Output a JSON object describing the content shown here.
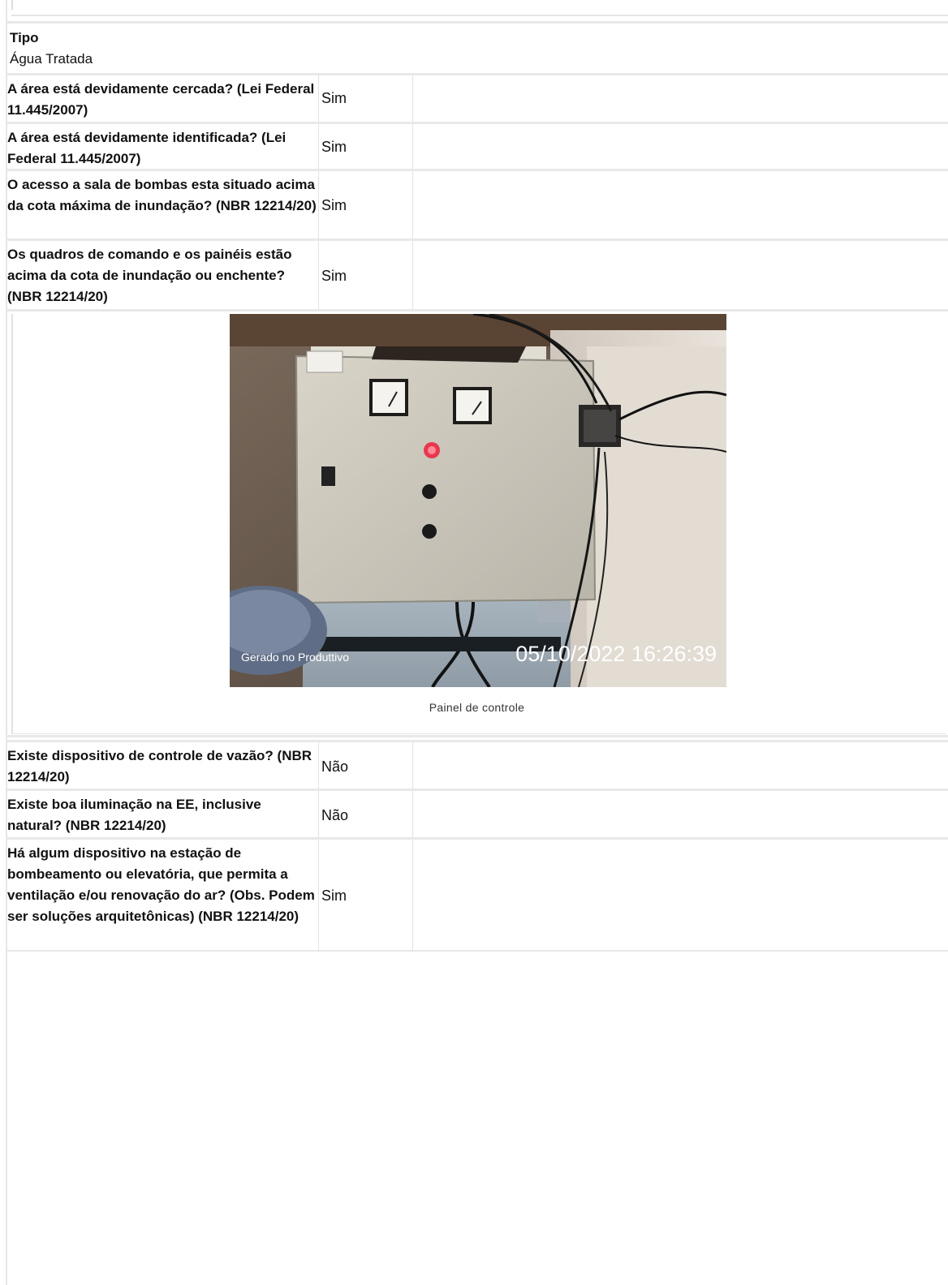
{
  "tipo": {
    "label": "Tipo",
    "value": "Água Tratada"
  },
  "rows_top": [
    {
      "question": "A área está devidamente cercada? (Lei Federal 11.445/2007)",
      "answer": "Sim"
    },
    {
      "question": "A área está devidamente identificada? (Lei Federal 11.445/2007)",
      "answer": "Sim"
    },
    {
      "question": "O acesso a sala de bombas esta situado acima da cota máxima de inundação? (NBR 12214/20)",
      "answer": "Sim"
    },
    {
      "question": "Os quadros de comando e os painéis estão acima da cota de inundação ou enchente? (NBR 12214/20)",
      "answer": "Sim"
    }
  ],
  "photo": {
    "watermark_left": "Gerado no Produttivo",
    "timestamp": "05/10/2022 16:26:39",
    "caption": "Painel de controle"
  },
  "rows_bottom": [
    {
      "question": "Existe dispositivo de controle de vazão? (NBR 12214/20)",
      "answer": "Não"
    },
    {
      "question": "Existe boa iluminação na EE, inclusive natural? (NBR 12214/20)",
      "answer": "Não"
    },
    {
      "question": "Há algum dispositivo na estação de bombeamento ou elevatória, que permita a ventilação e/ou renovação do ar? (Obs. Podem ser soluções arquitetônicas) (NBR 12214/20)",
      "answer": "Sim"
    }
  ]
}
